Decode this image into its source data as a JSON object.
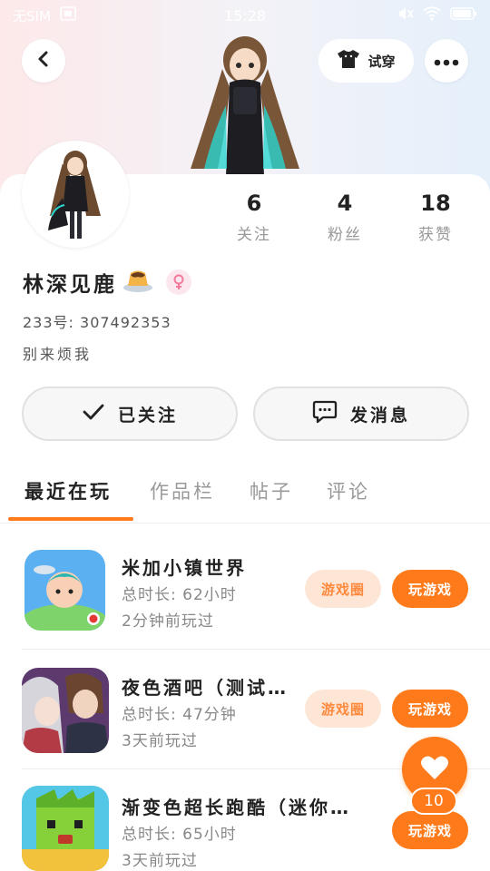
{
  "status_bar": {
    "carrier": "无SIM",
    "time": "15:28"
  },
  "header": {
    "back_icon": "chevron-left-icon",
    "tryon_label": "试穿",
    "tryon_icon": "tshirt-icon",
    "more_icon": "more-horizontal-icon"
  },
  "profile": {
    "stats": [
      {
        "value": "6",
        "label": "关注"
      },
      {
        "value": "4",
        "label": "粉丝"
      },
      {
        "value": "18",
        "label": "获赞"
      }
    ],
    "username": "林深见鹿",
    "uid": "233号: 307492353",
    "bio": "别来烦我",
    "follow_button": "已关注",
    "message_button": "发消息"
  },
  "tabs": [
    {
      "label": "最近在玩",
      "active": true
    },
    {
      "label": "作品栏",
      "active": false
    },
    {
      "label": "帖子",
      "active": false
    },
    {
      "label": "评论",
      "active": false
    }
  ],
  "games": [
    {
      "title": "米加小镇世界",
      "duration": "总时长: 62小时",
      "last_played": "2分钟前玩过",
      "circle_label": "游戏圈",
      "play_label": "玩游戏",
      "has_circle": true
    },
    {
      "title": "夜色酒吧（测试…",
      "duration": "总时长: 47分钟",
      "last_played": "3天前玩过",
      "circle_label": "游戏圈",
      "play_label": "玩游戏",
      "has_circle": true
    },
    {
      "title": "渐变色超长跑酷（迷你…",
      "duration": "总时长: 65小时",
      "last_played": "3天前玩过",
      "circle_label": "",
      "play_label": "玩游戏",
      "has_circle": false
    }
  ],
  "like": {
    "icon": "heart-icon",
    "count": "10"
  },
  "colors": {
    "accent": "#ff7a1a",
    "accent_light": "#fde6d6"
  }
}
